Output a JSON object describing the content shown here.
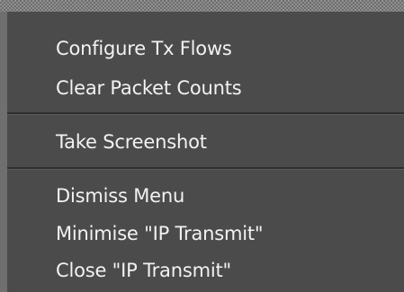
{
  "menu": {
    "group1": {
      "configure_tx_flows": "Configure Tx Flows",
      "clear_packet_counts": "Clear Packet Counts"
    },
    "group2": {
      "take_screenshot": "Take Screenshot"
    },
    "group3": {
      "dismiss_menu": "Dismiss Menu",
      "minimise": "Minimise \"IP Transmit\"",
      "close": "Close \"IP Transmit\""
    }
  },
  "colors": {
    "menu_background": "#4b4b4b",
    "text": "#f2f2f2",
    "separator": "#2f2f2f"
  }
}
